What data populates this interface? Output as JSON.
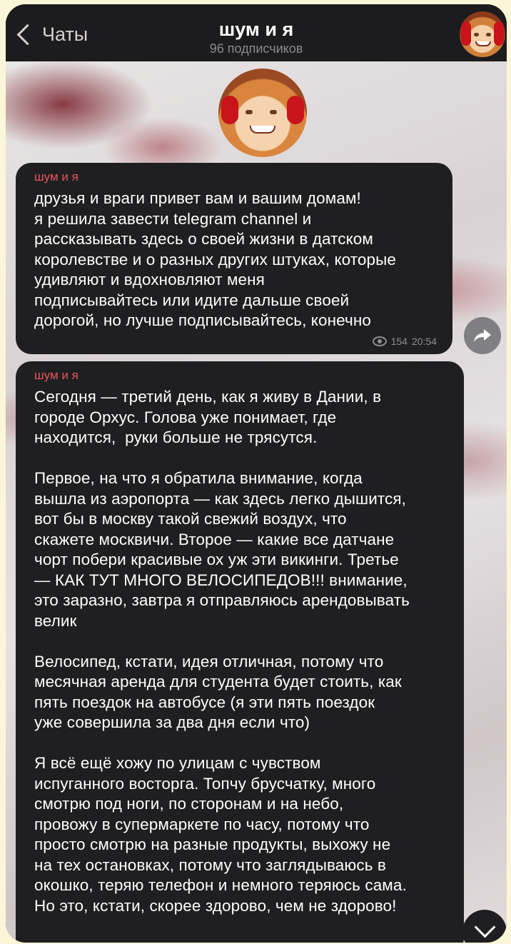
{
  "header": {
    "back_label": "Чаты",
    "title": "шум и я",
    "subtitle": "96 подписчиков",
    "avatar": "channel-avatar"
  },
  "messages": [
    {
      "sender": "шум и я",
      "text": "друзья и враги привет вам и вашим домам!\nя решила завести telegram channel и\nрассказывать здесь о своей жизни в датском\nкоролевстве и о разных других штуках, которые\nудивляют и вдохновляют меня\nподписывайтесь или идите дальше своей\nдорогой, но лучше подписывайтесь, конечно",
      "views": "154",
      "time": "20:54"
    },
    {
      "sender": "шум и я",
      "text": "Сегодня — третий день, как я живу в Дании, в\nгороде Орхус. Голова уже понимает, где\nнаходится,  руки больше не трясутся.\n\nПервое, на что я обратила внимание, когда\nвышла из аэропорта — как здесь легко дышится,\nвот бы в москву такой свежий воздух, что\nскажете москвичи. Второе — какие все датчане\nчорт побери красивые ох уж эти викинги. Третье\n— КАК ТУТ МНОГО ВЕЛОСИПЕДОВ!!! внимание,\nэто заразно, завтра я отправляюсь арендовывать\nвелик\n\nВелосипед, кстати, идея отличная, потому что\nмесячная аренда для студента будет стоить, как\nпять поездок на автобусе (я эти пять поездок\nуже совершила за два дня если что)\n\nЯ всё ещё хожу по улицам с чувством\nиспуганного восторга. Топчу брусчатку, много\nсмотрю под ноги, по сторонам и на небо,\nпровожу в супермаркете по часу, потому что\nпросто смотрю на разные продукты, выхожу не\nна тех остановках, потому что заглядываюсь в\nокошко, теряю телефон и немного теряюсь сама.\nНо это, кстати, скорее здорово, чем не здорово!"
    }
  ],
  "colors": {
    "sender_name": "#e5555b",
    "bubble_bg": "#1f1f21",
    "meta_text": "#8e8e93"
  },
  "icons": [
    "back-chevron-icon",
    "eye-icon",
    "share-arrow-icon",
    "chevron-down-icon"
  ]
}
